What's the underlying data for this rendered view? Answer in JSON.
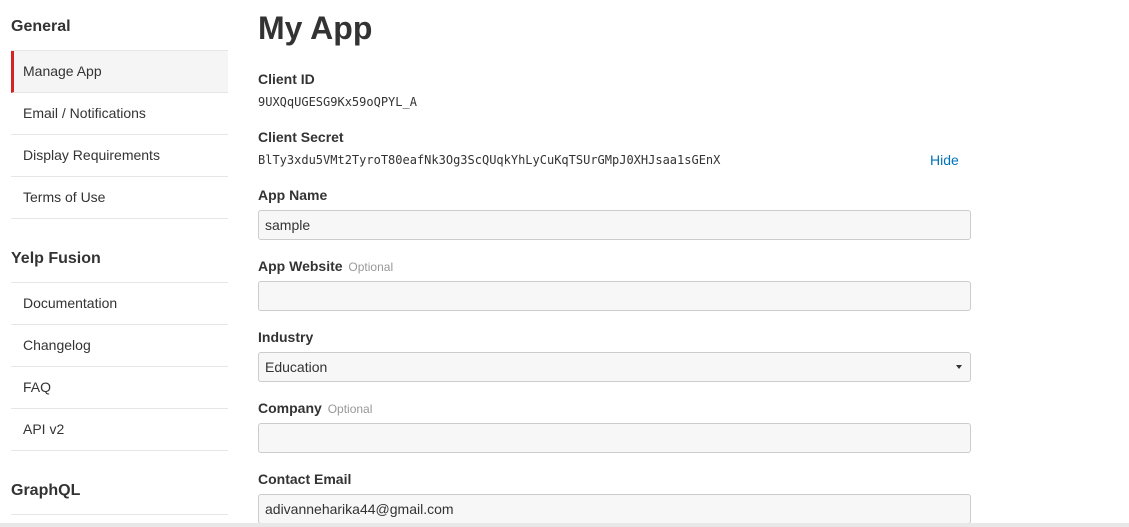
{
  "sidebar": {
    "sections": [
      {
        "title": "General",
        "items": [
          {
            "label": "Manage App"
          },
          {
            "label": "Email / Notifications"
          },
          {
            "label": "Display Requirements"
          },
          {
            "label": "Terms of Use"
          }
        ]
      },
      {
        "title": "Yelp Fusion",
        "items": [
          {
            "label": "Documentation"
          },
          {
            "label": "Changelog"
          },
          {
            "label": "FAQ"
          },
          {
            "label": "API v2"
          }
        ]
      },
      {
        "title": "GraphQL",
        "items": []
      }
    ],
    "active_item": "Manage App",
    "active_color": "#d32323"
  },
  "main": {
    "title": "My App",
    "client_id": {
      "label": "Client ID",
      "value": "9UXQqUGESG9Kx59oQPYL_A"
    },
    "client_secret": {
      "label": "Client Secret",
      "value": "BlTy3xdu5VMt2TyroT80eafNk3Og3ScQUqkYhLyCuKqTSUrGMpJ0XHJsaa1sGEnX",
      "hide_label": "Hide"
    },
    "app_name": {
      "label": "App Name",
      "value": "sample"
    },
    "app_website": {
      "label": "App Website",
      "optional": "Optional",
      "value": ""
    },
    "industry": {
      "label": "Industry",
      "value": "Education"
    },
    "company": {
      "label": "Company",
      "optional": "Optional",
      "value": ""
    },
    "contact_email": {
      "label": "Contact Email",
      "value": "adivanneharika44@gmail.com"
    },
    "link_color": "#0073bb"
  }
}
